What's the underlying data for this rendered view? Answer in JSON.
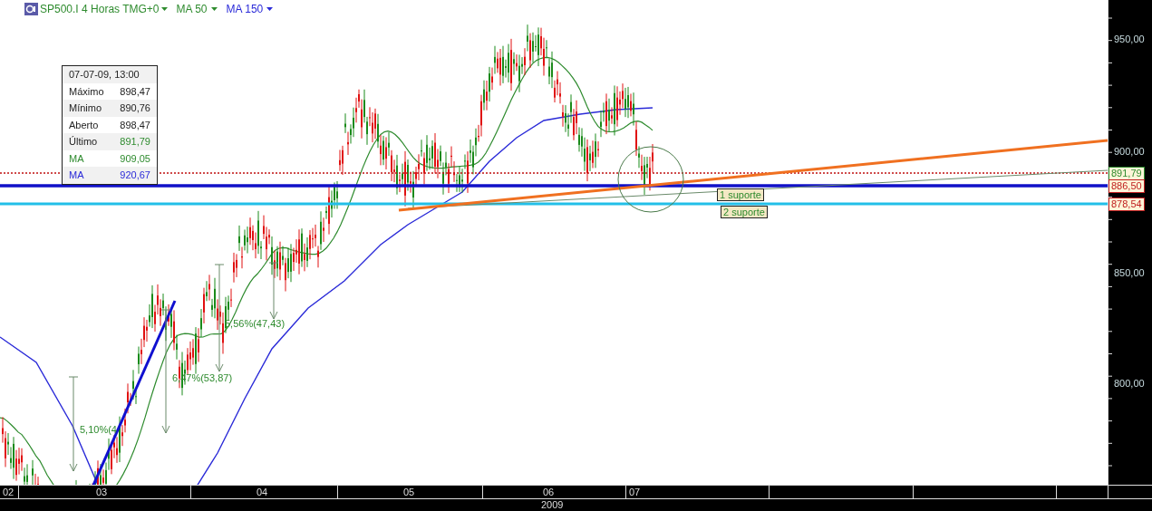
{
  "header": {
    "symbol": "SP500.I 4 Horas TMG+0",
    "indicators": [
      {
        "label": "MA 50",
        "color": "#2e8b2e"
      },
      {
        "label": "MA 150",
        "color": "#2a2ad8"
      }
    ]
  },
  "tooltip": {
    "date": "07-07-09, 13:00",
    "rows": [
      {
        "label": "Máximo",
        "value": "898,47",
        "kind": "price"
      },
      {
        "label": "Mínimo",
        "value": "890,76",
        "kind": "price"
      },
      {
        "label": "Aberto",
        "value": "898,47",
        "kind": "price"
      },
      {
        "label": "Último",
        "value": "891,79",
        "kind": "close"
      },
      {
        "label": "MA",
        "value": "909,05",
        "kind": "ma50"
      },
      {
        "label": "MA",
        "value": "920,67",
        "kind": "ma150"
      }
    ]
  },
  "price_axis": {
    "ticks": [
      "950,00",
      "900,00",
      "850,00",
      "800,00"
    ],
    "markers": [
      {
        "value": "891,79",
        "color": "#2e8b2e"
      },
      {
        "value": "886,50",
        "color": "#c02020"
      },
      {
        "value": "878,54",
        "color": "#c02020"
      }
    ]
  },
  "time_axis": {
    "months": [
      "02",
      "03",
      "04",
      "05",
      "06",
      "07"
    ],
    "year": "2009"
  },
  "annotations": {
    "supports": [
      "1 suporte",
      "2 suporte"
    ],
    "moves": [
      "5,10%(4",
      "6,47%(53,87)",
      "5,56%(47,43)"
    ]
  }
}
